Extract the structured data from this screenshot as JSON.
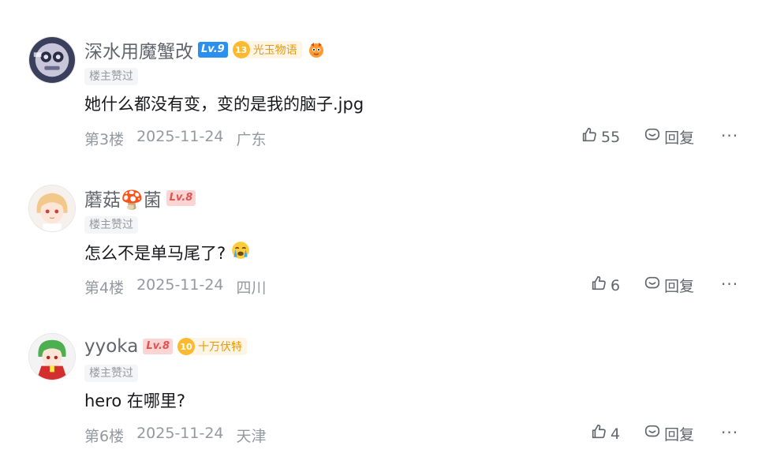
{
  "op_tag_label": "楼主赞过",
  "reply_label": "回复",
  "more_label": "···",
  "comments": [
    {
      "username": "深水用魔蟹改",
      "level": "Lv.9",
      "medal": {
        "level": "13",
        "name": "光玉物语"
      },
      "sticker_icon": "face-sticker-icon",
      "content": "她什么都没有变，变的是我的脑子.jpg",
      "floor": "第3楼",
      "date": "2025-11-24",
      "location": "广东",
      "likes": "55"
    },
    {
      "username": "蘑菇🍄菌",
      "level": "Lv.8",
      "content": "怎么不是单马尾了?",
      "content_emoji_icon": "crying-emoji-icon",
      "floor": "第4楼",
      "date": "2025-11-24",
      "location": "四川",
      "likes": "6"
    },
    {
      "username": "yyoka",
      "level": "Lv.8",
      "medal": {
        "level": "10",
        "name": "十万伏特"
      },
      "content": "hero 在哪里?",
      "floor": "第6楼",
      "date": "2025-11-24",
      "location": "天津",
      "likes": "4"
    }
  ],
  "colors": {
    "level_blue": "#2b8ff0",
    "level_red": "#e0534f",
    "medal_gold": "#ffb92e",
    "meta_gray": "#9499a0"
  }
}
